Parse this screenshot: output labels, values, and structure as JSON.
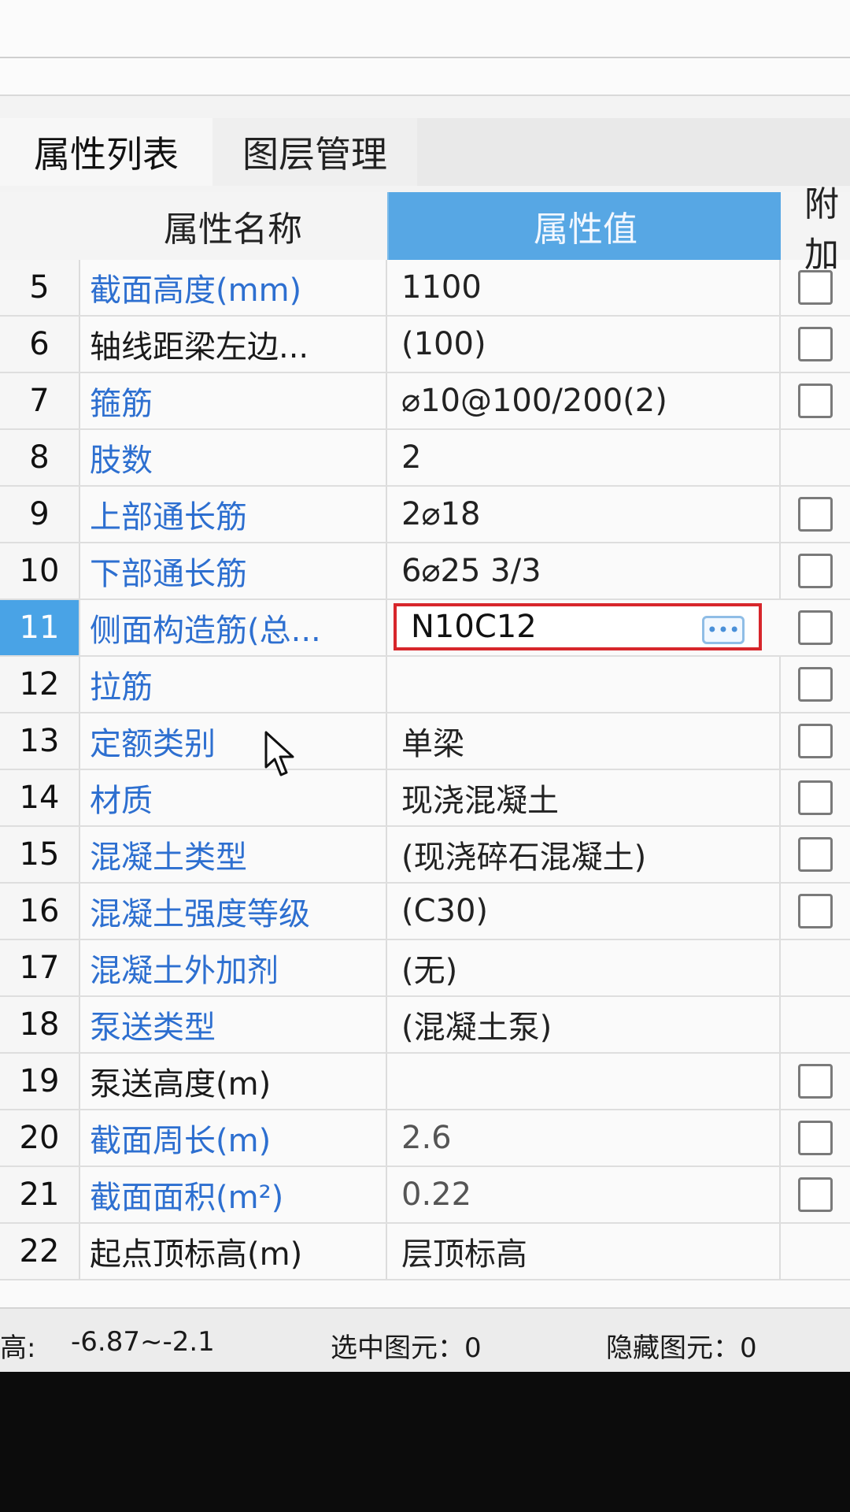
{
  "tabs": {
    "active": "属性列表",
    "inactive": "图层管理"
  },
  "header": {
    "name": "属性名称",
    "value": "属性值",
    "extra": "附加"
  },
  "rows": [
    {
      "num": "5",
      "name": "截面高度(mm)",
      "value": "1100",
      "blue": true,
      "checkbox": true
    },
    {
      "num": "6",
      "name": "轴线距梁左边...",
      "value": "(100)",
      "blue": false,
      "checkbox": true
    },
    {
      "num": "7",
      "name": "箍筋",
      "value": "⌀10@100/200(2)",
      "blue": true,
      "checkbox": true
    },
    {
      "num": "8",
      "name": "肢数",
      "value": "2",
      "blue": true,
      "checkbox": false
    },
    {
      "num": "9",
      "name": "上部通长筋",
      "value": "2⌀18",
      "blue": true,
      "checkbox": true
    },
    {
      "num": "10",
      "name": "下部通长筋",
      "value": "6⌀25 3/3",
      "blue": true,
      "checkbox": true
    },
    {
      "num": "11",
      "name": "侧面构造筋(总...",
      "value": "N10C12",
      "blue": true,
      "checkbox": true,
      "selected": true
    },
    {
      "num": "12",
      "name": "拉筋",
      "value": "",
      "blue": true,
      "checkbox": true
    },
    {
      "num": "13",
      "name": "定额类别",
      "value": "单梁",
      "blue": true,
      "checkbox": true
    },
    {
      "num": "14",
      "name": "材质",
      "value": "现浇混凝土",
      "blue": true,
      "checkbox": true
    },
    {
      "num": "15",
      "name": "混凝土类型",
      "value": "(现浇碎石混凝土)",
      "blue": true,
      "checkbox": true
    },
    {
      "num": "16",
      "name": "混凝土强度等级",
      "value": "(C30)",
      "blue": true,
      "checkbox": true
    },
    {
      "num": "17",
      "name": "混凝土外加剂",
      "value": "(无)",
      "blue": true,
      "checkbox": false
    },
    {
      "num": "18",
      "name": "泵送类型",
      "value": "(混凝土泵)",
      "blue": true,
      "checkbox": false
    },
    {
      "num": "19",
      "name": "泵送高度(m)",
      "value": "",
      "blue": false,
      "checkbox": true
    },
    {
      "num": "20",
      "name": "截面周长(m)",
      "value": "2.6",
      "blue": true,
      "checkbox": true,
      "grayValue": true
    },
    {
      "num": "21",
      "name": "截面面积(m²)",
      "value": "0.22",
      "blue": true,
      "checkbox": true,
      "grayValue": true
    },
    {
      "num": "22",
      "name": "起点顶标高(m)",
      "value": "层顶标高",
      "blue": false,
      "checkbox": false
    }
  ],
  "status": {
    "elevation_label": "高:",
    "elevation_value": "-6.87~-2.1",
    "selected": "选中图元：0",
    "hidden": "隐藏图元：0"
  }
}
